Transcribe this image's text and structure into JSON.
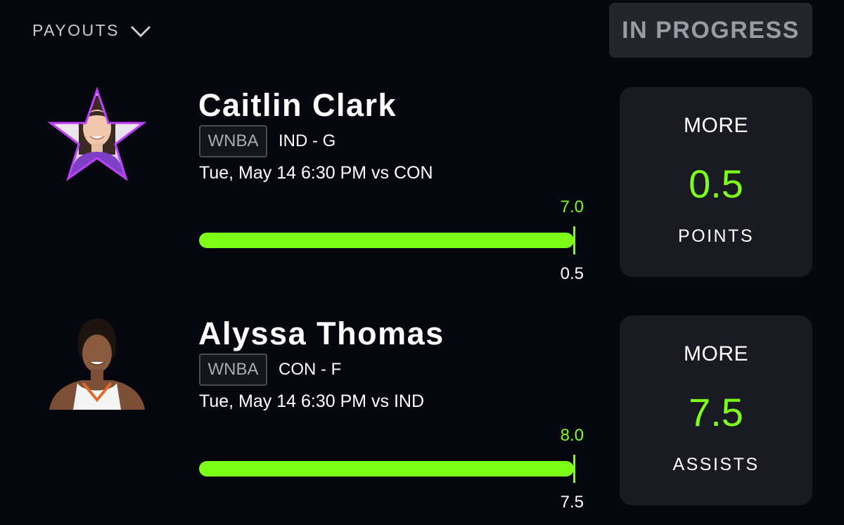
{
  "header": {
    "payouts_label": "PAYOUTS",
    "status_label": "IN PROGRESS"
  },
  "colors": {
    "accent": "#7dff1a",
    "background": "#07080f",
    "card": "#1a1b22",
    "badge": "#24262d",
    "star_outline": "#c040ff"
  },
  "picks": [
    {
      "player_name": "Caitlin Clark",
      "league": "WNBA",
      "team_position": "IND - G",
      "game_info": "Tue, May 14 6:30 PM  vs CON",
      "actual_value": "7.0",
      "line_value": "0.5",
      "progress_percent": 100,
      "direction": "MORE",
      "line": "0.5",
      "stat_type": "POINTS",
      "avatar": "star-framed-player-photo"
    },
    {
      "player_name": "Alyssa Thomas",
      "league": "WNBA",
      "team_position": "CON - F",
      "game_info": "Tue, May 14 6:30 PM  vs IND",
      "actual_value": "8.0",
      "line_value": "7.5",
      "progress_percent": 100,
      "direction": "MORE",
      "line": "7.5",
      "stat_type": "ASSISTS",
      "avatar": "player-photo"
    }
  ]
}
